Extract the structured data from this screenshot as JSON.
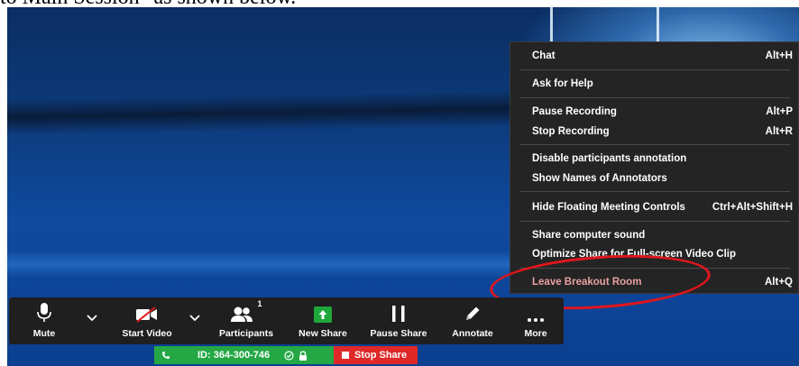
{
  "document": {
    "text": "to Main Session\" as shown below."
  },
  "menu": {
    "items": [
      {
        "label": "Chat",
        "shortcut": "Alt+H"
      },
      {
        "label": "Ask for Help",
        "shortcut": ""
      },
      {
        "label": "Pause Recording",
        "shortcut": "Alt+P"
      },
      {
        "label": "Stop Recording",
        "shortcut": "Alt+R"
      },
      {
        "label": "Disable participants annotation",
        "shortcut": ""
      },
      {
        "label": "Show Names of Annotators",
        "shortcut": ""
      },
      {
        "label": "Hide Floating Meeting Controls",
        "shortcut": "Ctrl+Alt+Shift+H"
      },
      {
        "label": "Share computer sound",
        "shortcut": ""
      },
      {
        "label": "Optimize Share for Full-screen Video Clip",
        "shortcut": ""
      },
      {
        "label": "Leave Breakout Room",
        "shortcut": "Alt+Q"
      }
    ]
  },
  "toolbar": {
    "mute": "Mute",
    "start_video": "Start Video",
    "participants": "Participants",
    "participants_count": "1",
    "new_share": "New Share",
    "pause_share": "Pause Share",
    "annotate": "Annotate",
    "more": "More"
  },
  "meeting_bar": {
    "id_label": "ID: 364-300-746",
    "stop_share": "Stop Share"
  },
  "colors": {
    "leave_text": "#e8a0a0",
    "annotation_ring": "#e0161c",
    "meeting_green": "#24a845",
    "stop_red": "#e02828",
    "new_share_green": "#1fa83a"
  }
}
